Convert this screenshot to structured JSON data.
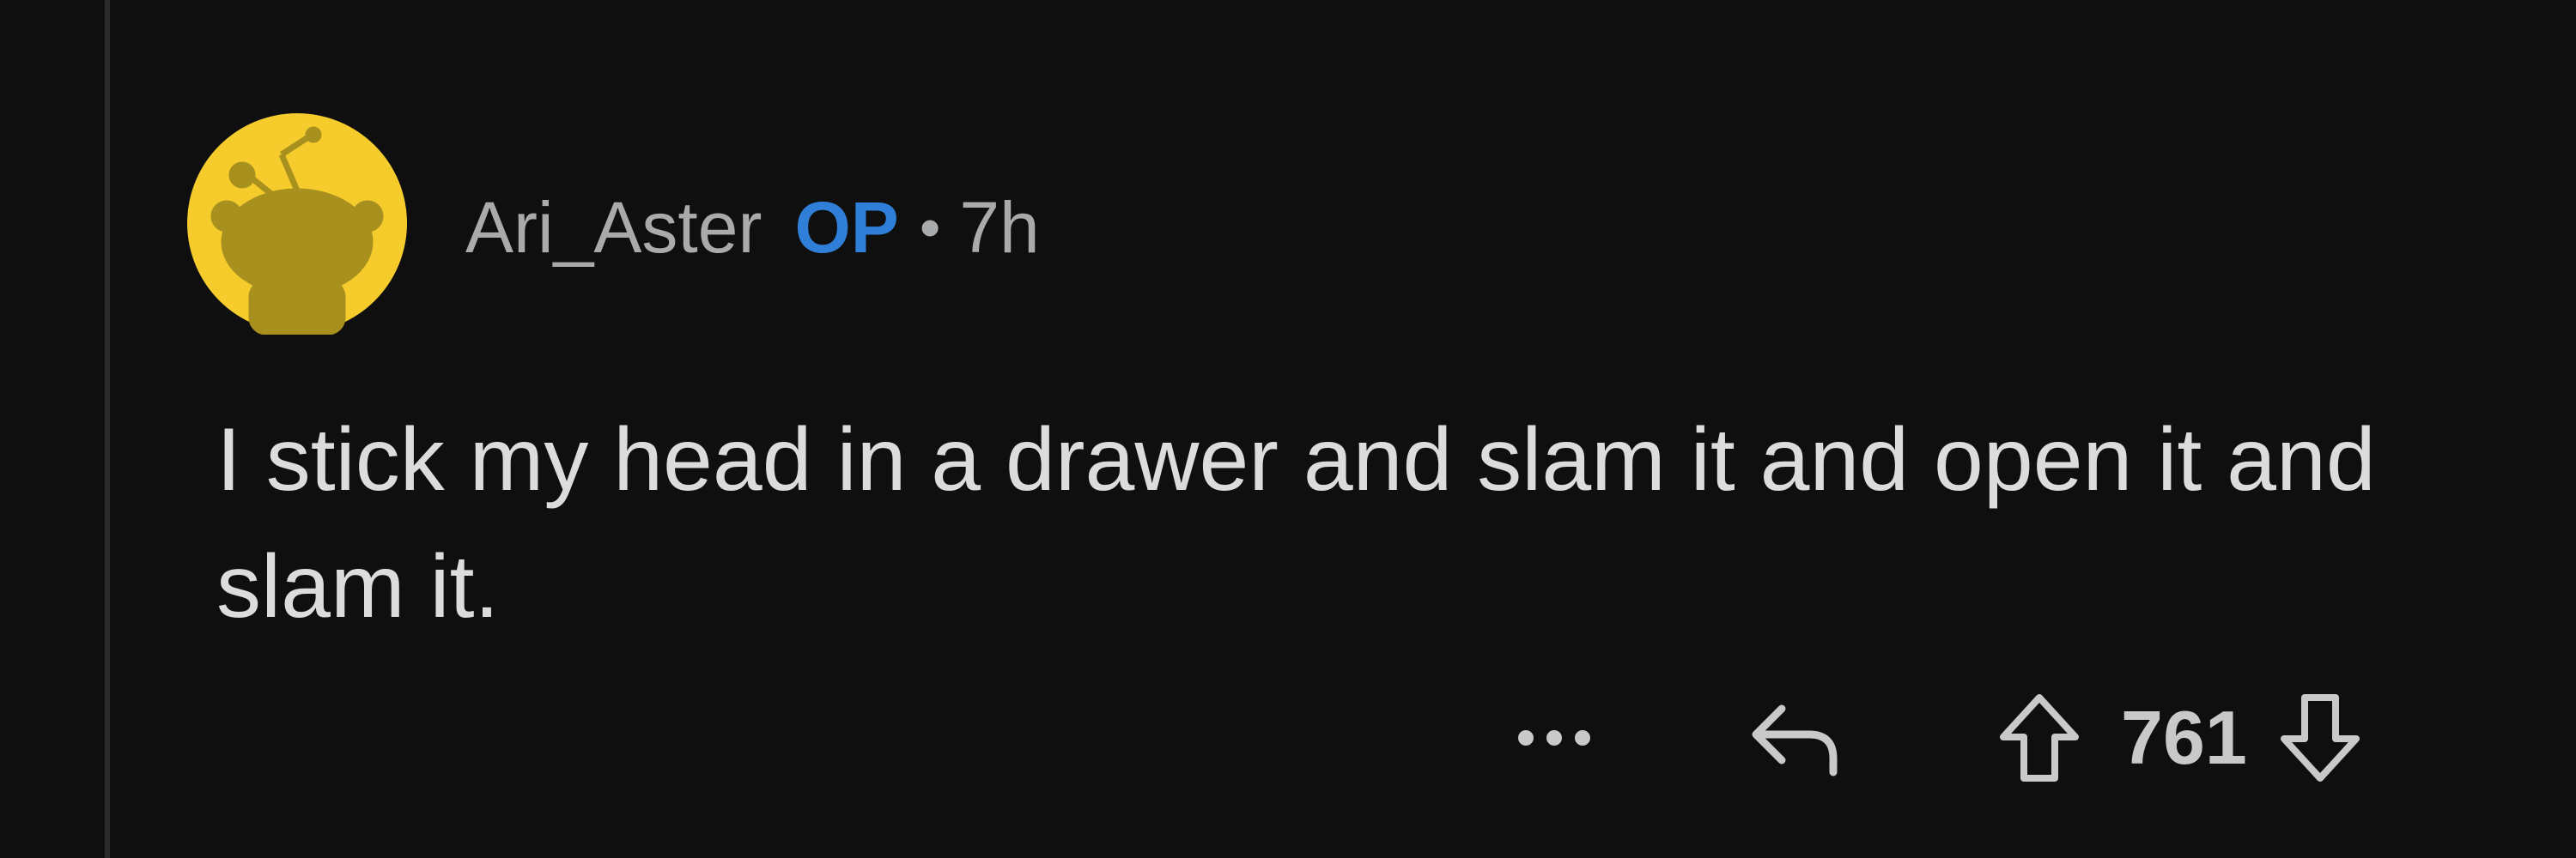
{
  "comment": {
    "author": "Ari_Aster",
    "op_badge": "OP",
    "separator": "•",
    "age": "7h",
    "body": "I stick my head in a drawer and slam it and open it and slam it.",
    "score": "761"
  },
  "actions": {
    "more_icon": "ellipsis-icon",
    "reply_icon": "reply-arrow-icon",
    "upvote_icon": "upvote-arrow-icon",
    "downvote_icon": "downvote-arrow-icon"
  },
  "colors": {
    "background": "#0f0f0f",
    "avatar": "#f5cc2c",
    "op_badge": "#2f7fd8",
    "muted_text": "#a8aaab",
    "body_text": "#dcdcdc"
  }
}
